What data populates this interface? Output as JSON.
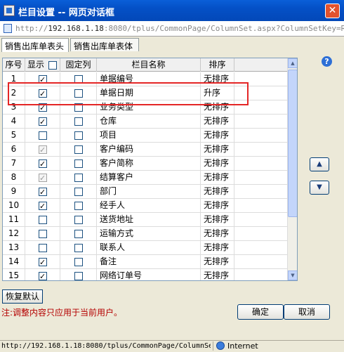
{
  "window": {
    "title": "栏目设置 -- 网页对话框",
    "close_glyph": "✕"
  },
  "address": {
    "prefix": "http://",
    "ip": "192.168.1.18",
    "rest": ":8080/tplus/CommonPage/ColumnSet.aspx?ColumnSetKey=RefSal"
  },
  "tabs": [
    {
      "label": "销售出库单表头",
      "active": true
    },
    {
      "label": "销售出库单表体",
      "active": false
    }
  ],
  "grid": {
    "headers": {
      "no": "序号",
      "show": "显示",
      "fixed": "固定列",
      "name": "栏目名称",
      "sort": "排序"
    },
    "rows": [
      {
        "no": "1",
        "show": true,
        "show_disabled": false,
        "fixed": false,
        "name": "单据编号",
        "sort": "无排序"
      },
      {
        "no": "2",
        "show": true,
        "show_disabled": false,
        "fixed": false,
        "name": "单据日期",
        "sort": "升序"
      },
      {
        "no": "3",
        "show": true,
        "show_disabled": false,
        "fixed": false,
        "name": "业务类型",
        "sort": "无排序"
      },
      {
        "no": "4",
        "show": true,
        "show_disabled": false,
        "fixed": false,
        "name": "仓库",
        "sort": "无排序"
      },
      {
        "no": "5",
        "show": false,
        "show_disabled": false,
        "fixed": false,
        "name": "项目",
        "sort": "无排序"
      },
      {
        "no": "6",
        "show": true,
        "show_disabled": true,
        "fixed": false,
        "name": "客户编码",
        "sort": "无排序"
      },
      {
        "no": "7",
        "show": true,
        "show_disabled": false,
        "fixed": false,
        "name": "客户简称",
        "sort": "无排序"
      },
      {
        "no": "8",
        "show": true,
        "show_disabled": true,
        "fixed": false,
        "name": "结算客户",
        "sort": "无排序"
      },
      {
        "no": "9",
        "show": true,
        "show_disabled": false,
        "fixed": false,
        "name": "部门",
        "sort": "无排序"
      },
      {
        "no": "10",
        "show": true,
        "show_disabled": false,
        "fixed": false,
        "name": "经手人",
        "sort": "无排序"
      },
      {
        "no": "11",
        "show": false,
        "show_disabled": false,
        "fixed": false,
        "name": "送货地址",
        "sort": "无排序"
      },
      {
        "no": "12",
        "show": false,
        "show_disabled": false,
        "fixed": false,
        "name": "运输方式",
        "sort": "无排序"
      },
      {
        "no": "13",
        "show": false,
        "show_disabled": false,
        "fixed": false,
        "name": "联系人",
        "sort": "无排序"
      },
      {
        "no": "14",
        "show": true,
        "show_disabled": false,
        "fixed": false,
        "name": "备注",
        "sort": "无排序"
      },
      {
        "no": "15",
        "show": true,
        "show_disabled": false,
        "fixed": false,
        "name": "网络订单号",
        "sort": "无排序"
      }
    ]
  },
  "help_glyph": "?",
  "move_up_glyph": "▲",
  "move_down_glyph": "▼",
  "buttons": {
    "restore": "恢复默认",
    "ok": "确定",
    "cancel": "取消"
  },
  "note": "注:调整内容只应用于当前用户。",
  "status": {
    "url": "http://192.168.1.18:8080/tplus/CommonPage/ColumnSet",
    "zone": "Internet"
  },
  "colors": {
    "highlight": "#e42626",
    "note": "#b40000",
    "titlebar": "#0450c6"
  }
}
